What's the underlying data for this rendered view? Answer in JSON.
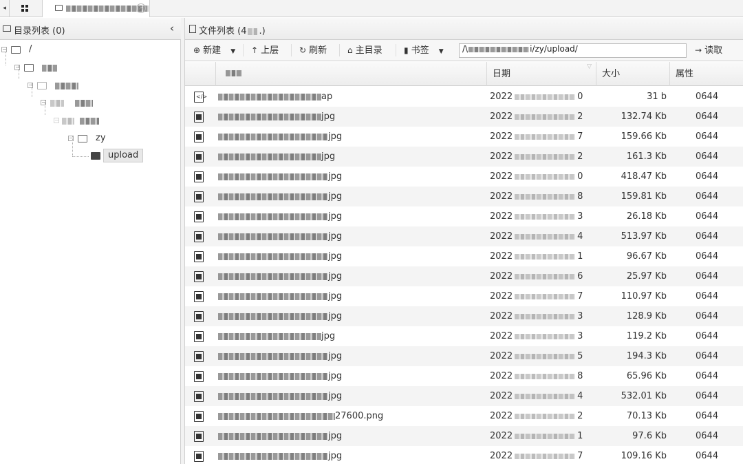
{
  "tabbar": {
    "arrow": "◂",
    "file_tab_close": "×"
  },
  "left_panel": {
    "title": "目录列表 (0)",
    "collapse_label": "‹",
    "tree": [
      {
        "label": "/"
      },
      {
        "label": ""
      },
      {
        "label": ""
      },
      {
        "label": ""
      },
      {
        "label": ""
      },
      {
        "label": "zy"
      },
      {
        "label": "upload",
        "selected": true
      }
    ]
  },
  "right_panel": {
    "title": "文件列表 (4",
    "title_suffix": ".)",
    "toolbar": {
      "new_label": "新建",
      "up_label": "上层",
      "refresh_label": "刷新",
      "home_label": "主目录",
      "bookmark_label": "书签",
      "path_value": "/\\",
      "path_visible_tail": "i/zy/upload/",
      "read_label": "读取"
    },
    "columns": [
      "",
      "",
      "日期",
      "大小",
      "属性"
    ],
    "rows": [
      {
        "type": "code",
        "name_tail": "ap",
        "date": "2022",
        "date_tail": "0",
        "size": "31 b",
        "perm": "0644"
      },
      {
        "type": "img",
        "name_tail": "jpg",
        "date": "2022",
        "date_tail": "2",
        "size": "132.74 Kb",
        "perm": "0644"
      },
      {
        "type": "img",
        "name_tail": "jpg",
        "date": "2022",
        "date_tail": "7",
        "size": "159.66 Kb",
        "perm": "0644"
      },
      {
        "type": "img",
        "name_tail": "jpg",
        "date": "2022",
        "date_tail": "2",
        "size": "161.3 Kb",
        "perm": "0644"
      },
      {
        "type": "img",
        "name_tail": "jpg",
        "date": "2022",
        "date_tail": "0",
        "size": "418.47 Kb",
        "perm": "0644"
      },
      {
        "type": "img",
        "name_tail": "jpg",
        "date": "2022",
        "date_tail": "8",
        "size": "159.81 Kb",
        "perm": "0644"
      },
      {
        "type": "img",
        "name_tail": "jpg",
        "date": "2022",
        "date_tail": "3",
        "size": "26.18 Kb",
        "perm": "0644"
      },
      {
        "type": "img",
        "name_tail": "jpg",
        "date": "2022",
        "date_tail": "4",
        "size": "513.97 Kb",
        "perm": "0644"
      },
      {
        "type": "img",
        "name_tail": "jpg",
        "date": "2022",
        "date_tail": "1",
        "size": "96.67 Kb",
        "perm": "0644"
      },
      {
        "type": "img",
        "name_tail": "jpg",
        "date": "2022",
        "date_tail": "6",
        "size": "25.97 Kb",
        "perm": "0644"
      },
      {
        "type": "img",
        "name_tail": "jpg",
        "date": "2022",
        "date_tail": "7",
        "size": "110.97 Kb",
        "perm": "0644"
      },
      {
        "type": "img",
        "name_tail": "jpg",
        "date": "2022",
        "date_tail": "3",
        "size": "128.9 Kb",
        "perm": "0644"
      },
      {
        "type": "img",
        "name_tail": "jpg",
        "date": "2022",
        "date_tail": "3",
        "size": "119.2 Kb",
        "perm": "0644"
      },
      {
        "type": "img",
        "name_tail": "jpg",
        "date": "2022",
        "date_tail": "5",
        "size": "194.3 Kb",
        "perm": "0644"
      },
      {
        "type": "img",
        "name_tail": "jpg",
        "date": "2022",
        "date_tail": "8",
        "size": "65.96 Kb",
        "perm": "0644"
      },
      {
        "type": "img",
        "name_tail": "jpg",
        "date": "2022",
        "date_tail": "4",
        "size": "532.01 Kb",
        "perm": "0644"
      },
      {
        "type": "img",
        "name_tail": "27600.png",
        "date": "2022",
        "date_tail": "2",
        "size": "70.13 Kb",
        "perm": "0644"
      },
      {
        "type": "img",
        "name_tail": "jpg",
        "date": "2022",
        "date_tail": "1",
        "size": "97.6 Kb",
        "perm": "0644"
      },
      {
        "type": "img",
        "name_tail": "jpg",
        "date": "2022",
        "date_tail": "7",
        "size": "109.16 Kb",
        "perm": "0644"
      }
    ]
  }
}
